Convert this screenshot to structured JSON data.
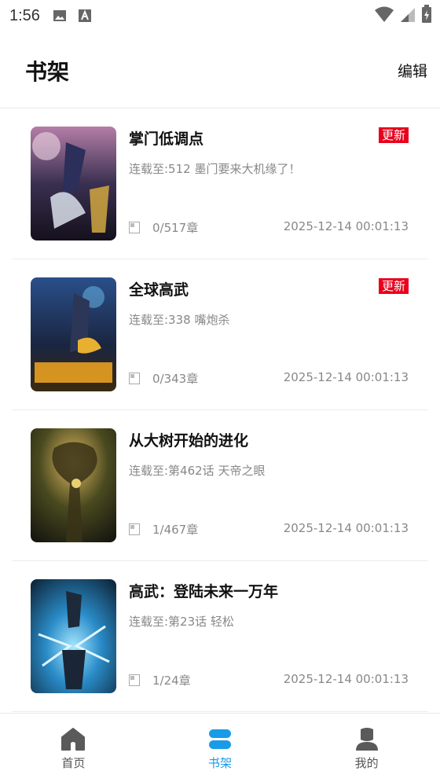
{
  "status_bar": {
    "time": "1:56"
  },
  "header": {
    "title": "书架",
    "edit_label": "编辑"
  },
  "books": [
    {
      "title": "掌门低调点",
      "badge": "更新",
      "latest": "连载至:512 墨门要来大机缘了！",
      "progress": "0/517章",
      "date": "2025-12-14 00:01:13"
    },
    {
      "title": "全球高武",
      "badge": "更新",
      "latest": "连载至:338 嘴炮杀",
      "progress": "0/343章",
      "date": "2025-12-14 00:01:13"
    },
    {
      "title": "从大树开始的进化",
      "badge": "",
      "latest": "连载至:第462话 天帝之眼",
      "progress": "1/467章",
      "date": "2025-12-14 00:01:13"
    },
    {
      "title": "高武：登陆未来一万年",
      "badge": "",
      "latest": "连载至:第23话 轻松",
      "progress": "1/24章",
      "date": "2025-12-14 00:01:13"
    }
  ],
  "bottom_nav": [
    {
      "label": "首页",
      "icon": "home-icon"
    },
    {
      "label": "书架",
      "icon": "bookshelf-icon",
      "active": true
    },
    {
      "label": "我的",
      "icon": "profile-icon"
    }
  ],
  "colors": {
    "accent": "#1a9be8",
    "badge": "#e8001d"
  }
}
